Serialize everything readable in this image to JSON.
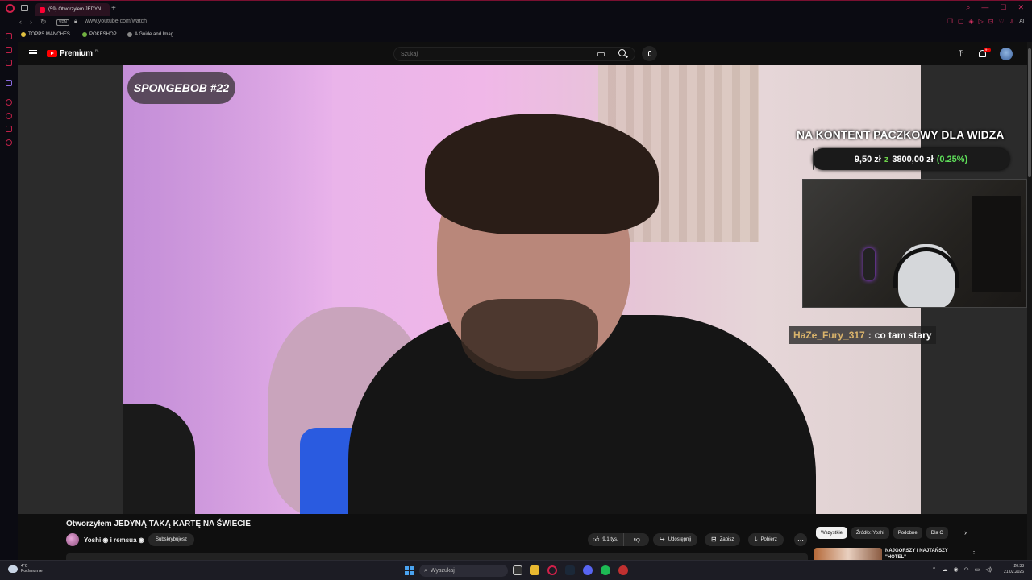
{
  "browser": {
    "tab_title": "(59) Otworzyłem JEDYN",
    "url": "www.youtube.com/watch",
    "vpn_label": "VPN",
    "ai_label": "AI",
    "bookmarks": [
      {
        "label": "TOPPS MANCHES...",
        "color": "#e0c040"
      },
      {
        "label": "POKESHOP",
        "color": "#70b040"
      },
      {
        "label": "A Guide and Imag...",
        "color": "#888888"
      }
    ]
  },
  "youtube": {
    "logo_text": "Premium",
    "logo_region": "PL",
    "search_placeholder": "Szukaj",
    "notifications_badge": "9+"
  },
  "video": {
    "badge": "SPONGEBOB #22",
    "overlay_title": "NA KONTENT PACZKOWY DLA WIDZA",
    "goal": {
      "current": "9,50 zł",
      "separator": "z",
      "target": "3800,00 zł",
      "percent": "(0.25%)",
      "fraction": 0.0025
    },
    "chat": {
      "user": "HaZe_Fury_317",
      "separator": ":",
      "message": "co tam stary"
    }
  },
  "details": {
    "title": "Otworzyłem JEDYNĄ TAKĄ KARTĘ NA ŚWIECIE",
    "channel": "Yoshi ◉ i remsua ◉",
    "subscribe_label": "Subskrybujesz",
    "likes": "9,1 tys.",
    "share_label": "Udostępnij",
    "save_label": "Zapisz",
    "download_label": "Pobierz",
    "more_label": "⋯"
  },
  "recommendations": {
    "chips": [
      "Wszystkie",
      "Źródło: Yoshi",
      "Podobne",
      "Dla C"
    ],
    "first_title": "NAJGORSZY I NAJTAŃSZY \"HOTEL\""
  },
  "taskbar": {
    "weather_temp": "4°C",
    "weather_desc": "Pochmurnie",
    "search_placeholder": "Wyszukaj",
    "time": "20:33",
    "date": "21.02.2026"
  },
  "colors": {
    "accent": "#ff0000",
    "opera": "#d0204a",
    "goal_green": "#5fe05a",
    "chat_user": "#d9b36b"
  }
}
